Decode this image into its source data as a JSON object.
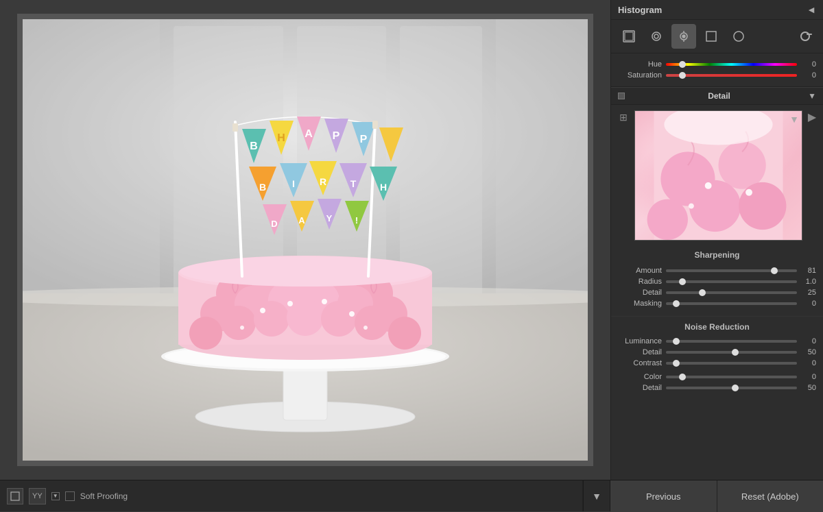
{
  "header": {
    "histogram_title": "Histogram",
    "histogram_arrow": "◄"
  },
  "tools": {
    "icons": [
      "crop",
      "heal",
      "adjustment-brush",
      "graduated-filter",
      "radial-filter",
      "white-balance"
    ]
  },
  "hue_saturation": {
    "hue_label": "Hue",
    "hue_value": "0",
    "saturation_label": "Saturation",
    "saturation_value": "0"
  },
  "detail_section": {
    "title": "Detail",
    "arrow": "▼"
  },
  "sharpening": {
    "title": "Sharpening",
    "amount_label": "Amount",
    "amount_value": "81",
    "radius_label": "Radius",
    "radius_value": "1.0",
    "detail_label": "Detail",
    "detail_value": "25",
    "masking_label": "Masking",
    "masking_value": "0"
  },
  "noise_reduction": {
    "title": "Noise Reduction",
    "luminance_label": "Luminance",
    "luminance_value": "0",
    "detail_label": "Detail",
    "detail_value": "50",
    "contrast_label": "Contrast",
    "contrast_value": "0",
    "color_label": "Color",
    "color_value": "0",
    "color_detail_label": "Detail",
    "color_detail_value": "50"
  },
  "toolbar": {
    "soft_proofing_label": "Soft Proofing",
    "previous_label": "Previous",
    "reset_label": "Reset (Adobe)"
  }
}
